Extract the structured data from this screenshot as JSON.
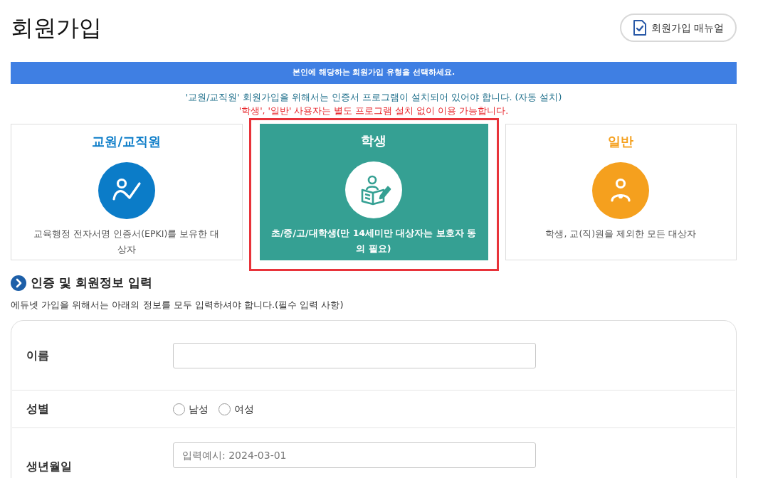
{
  "page_title": "회원가입",
  "manual_button": {
    "label": "회원가입 매뉴얼"
  },
  "banner": "본인에 해당하는 회원가입 유형을 선택하세요.",
  "notices": [
    {
      "text": "'교원/교직원' 회원가입을 위해서는 인증서 프로그램이 설치되어 있어야 합니다. (자동 설치)",
      "color": "#1f6f8b"
    },
    {
      "text": "'학생', '일반' 사용자는 별도 프로그램 설치 없이 이용 가능합니다.",
      "color": "#e8252b"
    }
  ],
  "member_types": [
    {
      "kind": "staff",
      "title": "교원/교직원",
      "description": "교육행정 전자서명 인증서(EPKI)를 보유한 대상자",
      "color": "#0b7cc8",
      "selected": false
    },
    {
      "kind": "student",
      "title": "학생",
      "description": "초/중/고/대학생(만 14세미만 대상자는 보호자 동의 필요)",
      "color": "#35a093",
      "selected": true
    },
    {
      "kind": "general",
      "title": "일반",
      "description": "학생, 교(직)원을 제외한 모든 대상자",
      "color": "#f5a01e",
      "selected": false
    }
  ],
  "section": {
    "title": "인증 및 회원정보 입력",
    "description": "에듀넷 가입을 위해서는 아래의 정보를 모두 입력하셔야 합니다.(필수 입력 사항)"
  },
  "form_rows": [
    {
      "kind": "text",
      "label": "이름"
    },
    {
      "kind": "radio",
      "label": "성별",
      "options": [
        {
          "label": "남성",
          "selected": false
        },
        {
          "label": "여성",
          "selected": false
        }
      ]
    },
    {
      "kind": "text",
      "label": "생년월일",
      "placeholder": "입력예시: 2024-03-01"
    }
  ]
}
